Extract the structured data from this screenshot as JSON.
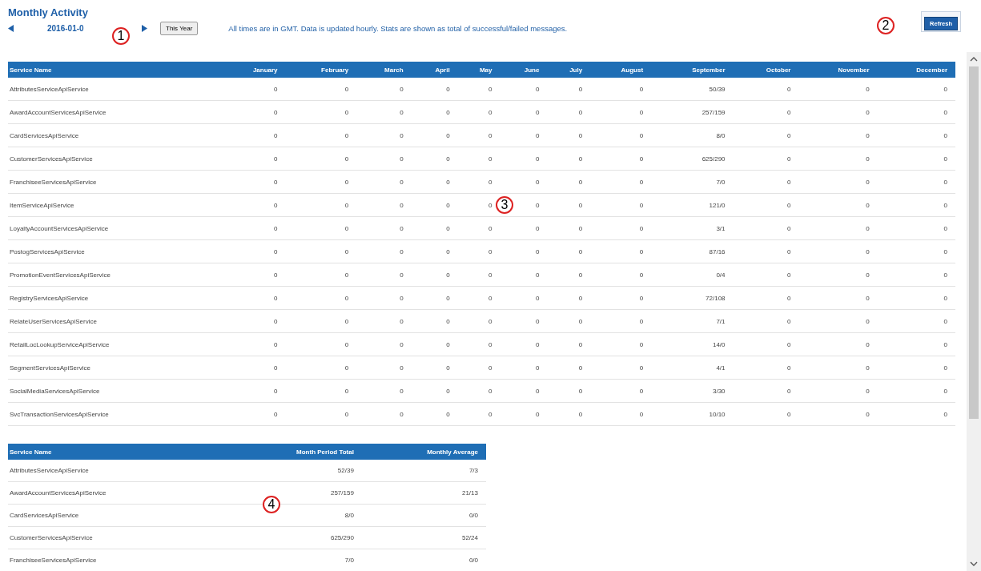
{
  "title": "Monthly Activity",
  "nav": {
    "date": "2016-01-0",
    "this_year_button": "This Year",
    "note": "All times are in GMT. Data is updated hourly. Stats are shown as total of successful/failed messages.",
    "refresh_button": "Refresh"
  },
  "callouts": [
    {
      "label": "1",
      "kind": "date"
    },
    {
      "label": "2",
      "kind": "refresh"
    },
    {
      "label": "3",
      "kind": "monthly"
    },
    {
      "label": "4",
      "kind": "summary"
    }
  ],
  "monthly_table": {
    "columns": [
      "Service Name",
      "January",
      "February",
      "March",
      "April",
      "May",
      "June",
      "July",
      "August",
      "September",
      "October",
      "November",
      "December"
    ],
    "rows": [
      {
        "name": "AttributesServiceApiService",
        "values": [
          "0",
          "0",
          "0",
          "0",
          "0",
          "0",
          "0",
          "0",
          "50/39",
          "0",
          "0",
          "0"
        ]
      },
      {
        "name": "AwardAccountServicesApiService",
        "values": [
          "0",
          "0",
          "0",
          "0",
          "0",
          "0",
          "0",
          "0",
          "257/159",
          "0",
          "0",
          "0"
        ]
      },
      {
        "name": "CardServicesApiService",
        "values": [
          "0",
          "0",
          "0",
          "0",
          "0",
          "0",
          "0",
          "0",
          "8/0",
          "0",
          "0",
          "0"
        ]
      },
      {
        "name": "CustomerServicesApiService",
        "values": [
          "0",
          "0",
          "0",
          "0",
          "0",
          "0",
          "0",
          "0",
          "625/290",
          "0",
          "0",
          "0"
        ]
      },
      {
        "name": "FranchiseeServicesApiService",
        "values": [
          "0",
          "0",
          "0",
          "0",
          "0",
          "0",
          "0",
          "0",
          "7/0",
          "0",
          "0",
          "0"
        ]
      },
      {
        "name": "ItemServiceApiService",
        "values": [
          "0",
          "0",
          "0",
          "0",
          "0",
          "0",
          "0",
          "0",
          "121/0",
          "0",
          "0",
          "0"
        ]
      },
      {
        "name": "LoyaltyAccountServicesApiService",
        "values": [
          "0",
          "0",
          "0",
          "0",
          "0",
          "0",
          "0",
          "0",
          "3/1",
          "0",
          "0",
          "0"
        ]
      },
      {
        "name": "PostogServicesApiService",
        "values": [
          "0",
          "0",
          "0",
          "0",
          "0",
          "0",
          "0",
          "0",
          "87/16",
          "0",
          "0",
          "0"
        ]
      },
      {
        "name": "PromotionEventServicesApiService",
        "values": [
          "0",
          "0",
          "0",
          "0",
          "0",
          "0",
          "0",
          "0",
          "0/4",
          "0",
          "0",
          "0"
        ]
      },
      {
        "name": "RegistryServicesApiService",
        "values": [
          "0",
          "0",
          "0",
          "0",
          "0",
          "0",
          "0",
          "0",
          "72/108",
          "0",
          "0",
          "0"
        ]
      },
      {
        "name": "RelateUserServicesApiService",
        "values": [
          "0",
          "0",
          "0",
          "0",
          "0",
          "0",
          "0",
          "0",
          "7/1",
          "0",
          "0",
          "0"
        ]
      },
      {
        "name": "RetailLocLookupServiceApiService",
        "values": [
          "0",
          "0",
          "0",
          "0",
          "0",
          "0",
          "0",
          "0",
          "14/0",
          "0",
          "0",
          "0"
        ]
      },
      {
        "name": "SegmentServicesApiService",
        "values": [
          "0",
          "0",
          "0",
          "0",
          "0",
          "0",
          "0",
          "0",
          "4/1",
          "0",
          "0",
          "0"
        ]
      },
      {
        "name": "SocialMediaServicesApiService",
        "values": [
          "0",
          "0",
          "0",
          "0",
          "0",
          "0",
          "0",
          "0",
          "3/30",
          "0",
          "0",
          "0"
        ]
      },
      {
        "name": "SvcTransactionServicesApiService",
        "values": [
          "0",
          "0",
          "0",
          "0",
          "0",
          "0",
          "0",
          "0",
          "10/10",
          "0",
          "0",
          "0"
        ]
      }
    ]
  },
  "summary_table": {
    "columns": [
      "Service Name",
      "Month Period Total",
      "Monthly Average"
    ],
    "rows": [
      {
        "name": "AttributesServiceApiService",
        "values": [
          "52/39",
          "7/3"
        ]
      },
      {
        "name": "AwardAccountServicesApiService",
        "values": [
          "257/159",
          "21/13"
        ]
      },
      {
        "name": "CardServicesApiService",
        "values": [
          "8/0",
          "0/0"
        ]
      },
      {
        "name": "CustomerServicesApiService",
        "values": [
          "625/290",
          "52/24"
        ]
      },
      {
        "name": "FranchiseeServicesApiService",
        "values": [
          "7/0",
          "0/0"
        ]
      }
    ]
  }
}
